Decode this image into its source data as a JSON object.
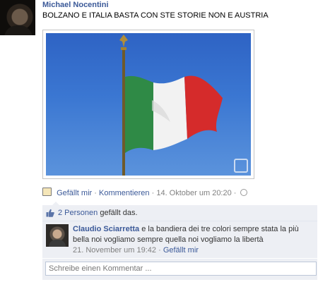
{
  "post": {
    "author": "Michael Nocentini",
    "text": "BOLZANO E ITALIA BASTA CON STE STORIE NON E AUSTRIA"
  },
  "actions": {
    "like_label": "Gefällt mir",
    "comment_label": "Kommentieren",
    "separator": "·",
    "timestamp": "14. Oktober um 20:20"
  },
  "likes": {
    "count_link": "2 Personen",
    "suffix": "gefällt das."
  },
  "comment": {
    "author": "Claudio Sciarretta",
    "text": "e la bandiera dei tre colori sempre stata la più bella noi vogliamo sempre quella noi vogliamo la libertà",
    "timestamp": "21. November um 19:42",
    "like_label": "Gefällt mir"
  },
  "composer": {
    "placeholder": "Schreibe einen Kommentar ..."
  },
  "colors": {
    "link": "#3b5998",
    "feedback_bg": "#edeff4",
    "flag_green": "#2f8a46",
    "flag_white": "#f2f2f2",
    "flag_red": "#d52b2b"
  }
}
